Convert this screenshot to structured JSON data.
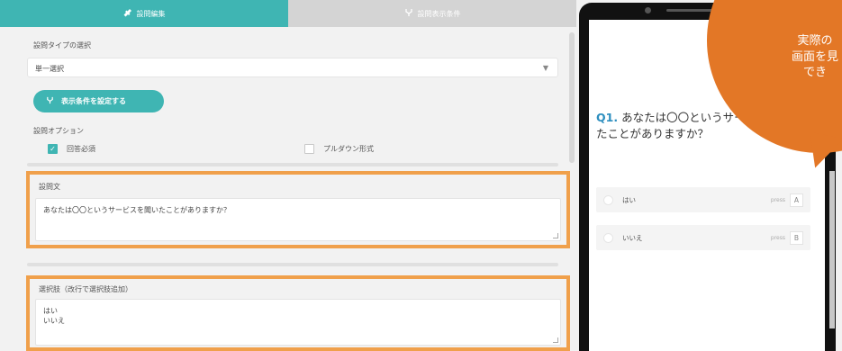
{
  "tabs": [
    {
      "label": "設問編集",
      "icon": "wrench-icon",
      "active": true
    },
    {
      "label": "設問表示条件",
      "icon": "branch-icon",
      "active": false
    }
  ],
  "editor": {
    "type_label": "設問タイプの選択",
    "type_value": "単一選択",
    "condition_button": "表示条件を設定する",
    "options_label": "設問オプション",
    "option_required": {
      "label": "回答必須",
      "checked": true
    },
    "option_pulldown": {
      "label": "プルダウン形式",
      "checked": false
    },
    "question_label": "設問文",
    "question_text": "あなたは〇〇というサービスを聞いたことがありますか？",
    "choices_label": "選択肢（改行で選択肢追加）",
    "choices_text": [
      "はい",
      "いいえ"
    ]
  },
  "preview": {
    "question_number": "Q1.",
    "question_text": "あなたは〇〇というサービスを聞いたことがありますか？",
    "choices": [
      {
        "label": "はい",
        "press": "press",
        "key": "A"
      },
      {
        "label": "いいえ",
        "press": "press",
        "key": "B"
      }
    ]
  },
  "callout": {
    "line1": "実際の",
    "line2": "画面を見",
    "line3": "でき",
    "color": "#e37726"
  },
  "colors": {
    "accent": "#3fb5b3",
    "highlight": "#f0a04b",
    "question_number": "#2e8fbf"
  }
}
